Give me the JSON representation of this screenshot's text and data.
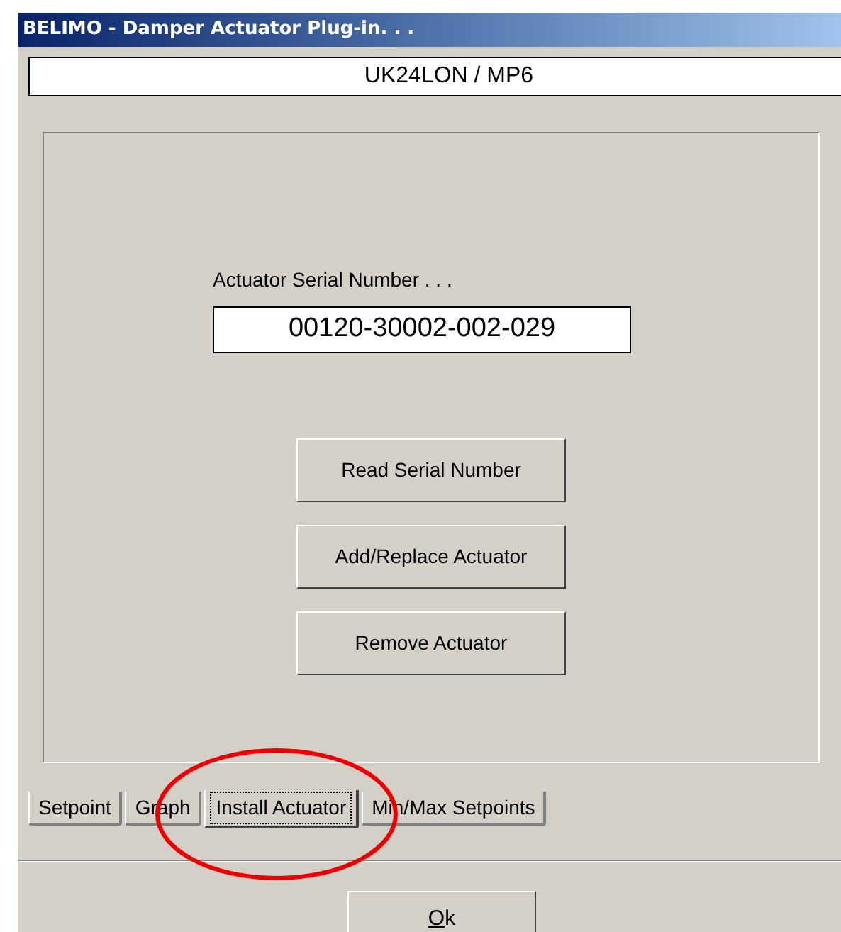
{
  "window": {
    "title": "BELIMO - Damper Actuator Plug-in. . ."
  },
  "model": "UK24LON / MP6",
  "serial": {
    "label": "Actuator Serial Number . . .",
    "value": "00120-30002-002-029"
  },
  "buttons": [
    "Read Serial Number",
    "Add/Replace Actuator",
    "Remove Actuator"
  ],
  "tabs": [
    {
      "label": "Setpoint",
      "selected": false
    },
    {
      "label": "Graph",
      "selected": false
    },
    {
      "label": "Install Actuator",
      "selected": true
    },
    {
      "label": "Min/Max Setpoints",
      "selected": false
    }
  ],
  "ok_button": {
    "mnemonic": "O",
    "rest": "k"
  }
}
